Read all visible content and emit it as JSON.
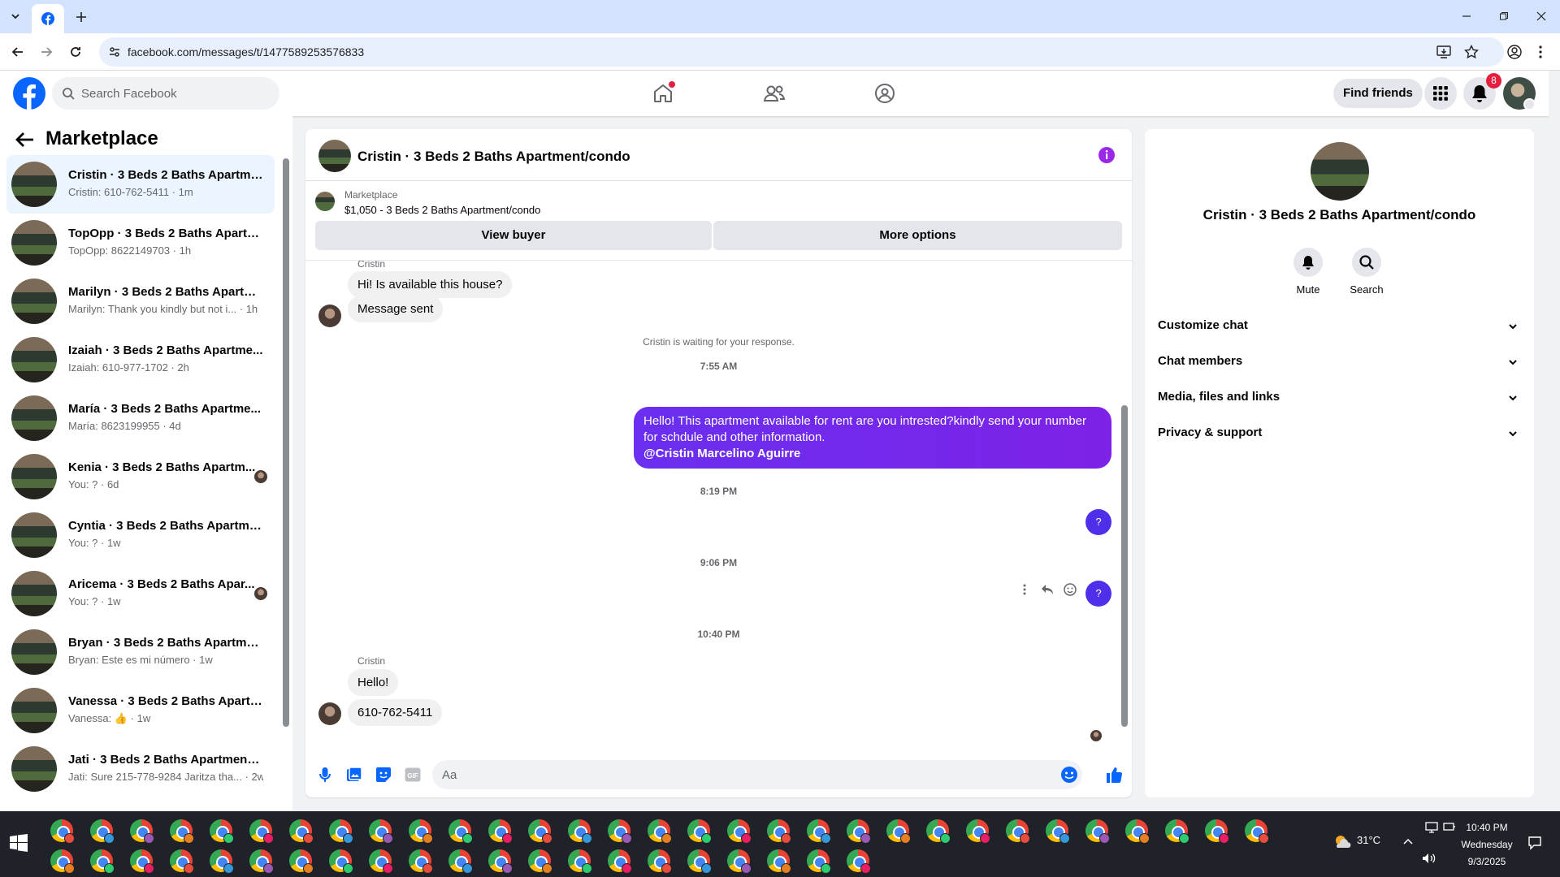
{
  "browser": {
    "url": "facebook.com/messages/t/1477589253576833"
  },
  "header": {
    "search_placeholder": "Search Facebook",
    "find_friends": "Find friends",
    "notification_count": "8"
  },
  "left": {
    "title": "Marketplace",
    "conversations": [
      {
        "name": "Cristin · 3 Beds 2 Baths Apartme...",
        "preview": "Cristin: 610-762-5411 · 1m",
        "active": true
      },
      {
        "name": "TopOpp · 3 Beds 2 Baths Apartm...",
        "preview": "TopOpp: 8622149703 · 1h"
      },
      {
        "name": "Marilyn · 3 Beds 2 Baths Apartm...",
        "preview": "Marilyn: Thank you kindly but not i... · 1h"
      },
      {
        "name": "Izaiah · 3 Beds 2 Baths Apartme...",
        "preview": "Izaiah: 610-977-1702 · 2h"
      },
      {
        "name": "María · 3 Beds 2 Baths Apartme...",
        "preview": "María: 8623199955 · 4d"
      },
      {
        "name": "Kenia · 3 Beds 2 Baths Apartm...",
        "preview": "You: ? · 6d"
      },
      {
        "name": "Cyntia · 3 Beds 2 Baths Apartme...",
        "preview": "You: ? · 1w"
      },
      {
        "name": "Aricema · 3 Beds 2 Baths Apar...",
        "preview": "You: ? · 1w"
      },
      {
        "name": "Bryan · 3 Beds 2 Baths Apartme...",
        "preview": "Bryan: Este es mi número · 1w"
      },
      {
        "name": "Vanessa · 3 Beds 2 Baths Apartm...",
        "preview": "Vanessa: 👍 · 1w"
      },
      {
        "name": "Jati · 3 Beds 2 Baths Apartment/...",
        "preview": "Jati: Sure 215-778-9284 Jaritza tha... · 2w"
      }
    ]
  },
  "chat": {
    "title": "Cristin · 3 Beds 2 Baths Apartment/condo",
    "marketplace_label": "Marketplace",
    "listing": "$1,050 - 3 Beds 2 Baths Apartment/condo",
    "view_buyer": "View buyer",
    "more_options": "More options",
    "sender_top": "Cristin",
    "msg1": "Hi! Is available this house?",
    "msg2": "Message sent",
    "waiting": "Cristin is waiting for your response.",
    "time1": "7:55 AM",
    "out_text": "Hello! This apartment available for rent are you intrested?kindly send your number for schdule and other information.",
    "out_mention": "@Cristin Marcelino Aguirre",
    "time2": "8:19 PM",
    "q1": "?",
    "time3": "9:06 PM",
    "q2": "?",
    "time4": "10:40 PM",
    "sender_bottom": "Cristin",
    "msg3": "Hello!",
    "msg4": "610-762-5411",
    "input_placeholder": "Aa"
  },
  "right": {
    "title": "Cristin · 3 Beds 2 Baths Apartment/condo",
    "mute": "Mute",
    "search": "Search",
    "sections": [
      "Customize chat",
      "Chat members",
      "Media, files and links",
      "Privacy & support"
    ]
  },
  "taskbar": {
    "temperature": "31°C",
    "time": "10:40 PM",
    "day": "Wednesday",
    "date": "9/3/2025"
  },
  "colors": {
    "fb_blue": "#0866ff",
    "outgoing_bubble": "#7f1dec",
    "active_conv": "#ebf5ff",
    "badge_red": "#e41e3f"
  }
}
